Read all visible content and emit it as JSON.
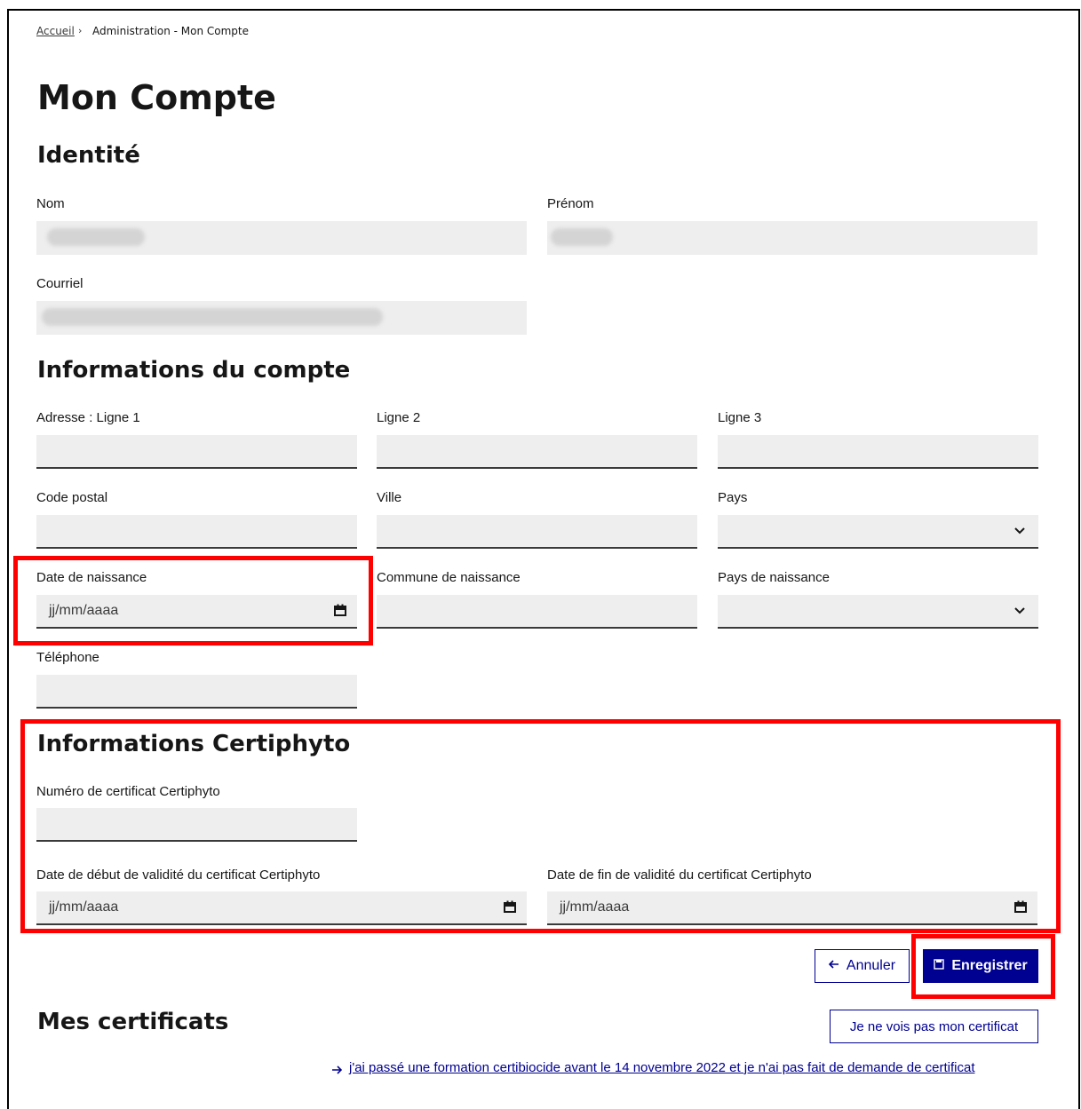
{
  "breadcrumb": {
    "home": "Accueil",
    "separator": "›",
    "current": "Administration - Mon Compte"
  },
  "page": {
    "title": "Mon Compte"
  },
  "identite": {
    "heading": "Identité",
    "nom_label": "Nom",
    "prenom_label": "Prénom",
    "courriel_label": "Courriel"
  },
  "compte": {
    "heading": "Informations du compte",
    "adresse1_label": "Adresse : Ligne 1",
    "adresse2_label": "Ligne 2",
    "adresse3_label": "Ligne 3",
    "code_postal_label": "Code postal",
    "ville_label": "Ville",
    "pays_label": "Pays",
    "date_naissance_label": "Date de naissance",
    "date_naissance_value": "jj/mm/aaaa",
    "commune_naissance_label": "Commune de naissance",
    "pays_naissance_label": "Pays de naissance",
    "telephone_label": "Téléphone"
  },
  "certiphyto": {
    "heading": "Informations Certiphyto",
    "numero_label": "Numéro de certificat Certiphyto",
    "debut_label": "Date de début de validité du certificat Certiphyto",
    "debut_value": "jj/mm/aaaa",
    "fin_label": "Date de fin de validité du certificat Certiphyto",
    "fin_value": "jj/mm/aaaa"
  },
  "actions": {
    "cancel_label": "Annuler",
    "save_label": "Enregistrer"
  },
  "certificats": {
    "heading": "Mes certificats",
    "missing_button": "Je ne vois pas mon certificat",
    "formation_link": "j'ai passé une formation certibiocide avant le 14 novembre 2022 et je n'ai pas fait de demande de certificat"
  },
  "colors": {
    "primary": "#000091",
    "highlight": "#ff0000",
    "field_bg": "#eeeeee"
  },
  "icons": [
    "chevron-down-icon",
    "calendar-icon",
    "arrow-left-icon",
    "save-icon",
    "arrow-right-icon"
  ]
}
